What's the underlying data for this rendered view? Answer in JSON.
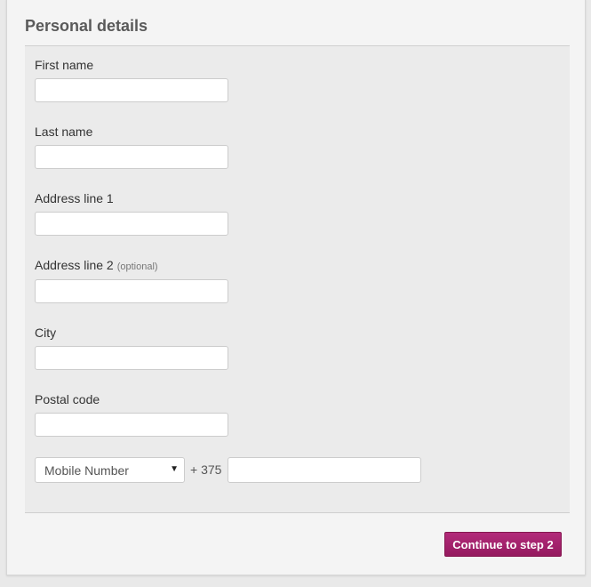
{
  "section": {
    "title": "Personal details"
  },
  "fields": [
    {
      "label": "First name",
      "value": ""
    },
    {
      "label": "Last name",
      "value": ""
    },
    {
      "label": "Address line 1",
      "value": ""
    },
    {
      "label": "Address line 2",
      "optional": "(optional)",
      "value": ""
    },
    {
      "label": "City",
      "value": ""
    },
    {
      "label": "Postal code",
      "value": ""
    }
  ],
  "phone": {
    "type_selected": "Mobile Number",
    "prefix": "+ 375",
    "value": ""
  },
  "button": {
    "label": "Continue to step 2",
    "color": "#a4226e"
  }
}
